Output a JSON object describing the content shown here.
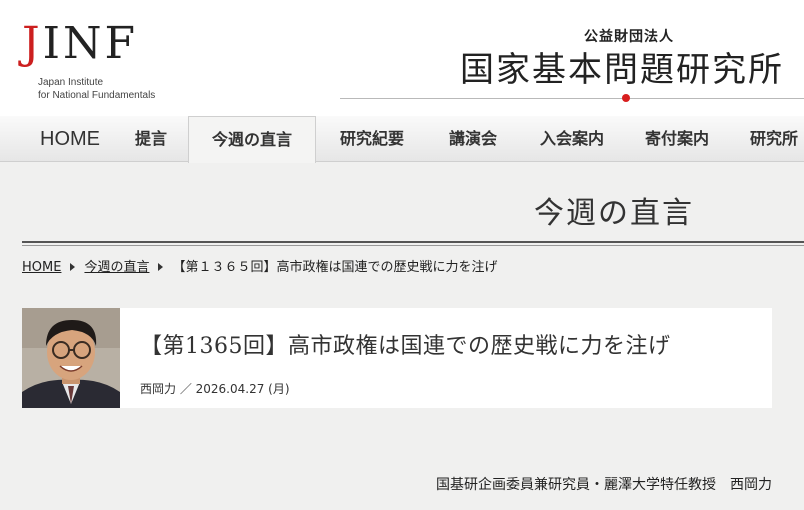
{
  "logo": {
    "letters_j": "J",
    "letters_rest": "INF",
    "en_line1": "Japan Institute",
    "en_line2": "for National Fundamentals"
  },
  "org": {
    "subtitle": "公益財団法人",
    "name": "国家基本問題研究所"
  },
  "nav": {
    "items": [
      {
        "label": "HOME"
      },
      {
        "label": "提言"
      },
      {
        "label": "今週の直言",
        "active": true
      },
      {
        "label": "研究紀要"
      },
      {
        "label": "講演会"
      },
      {
        "label": "入会案内"
      },
      {
        "label": "寄付案内"
      },
      {
        "label": "研究所"
      }
    ]
  },
  "section": {
    "title": "今週の直言"
  },
  "breadcrumb": {
    "home": "HOME",
    "parent": "今週の直言",
    "current": "【第１３６５回】高市政権は国連での歴史戦に力を注げ"
  },
  "article": {
    "title": "【第1365回】高市政権は国連での歴史戦に力を注げ",
    "meta": "西岡力 ／ 2026.04.27 (月)"
  },
  "byline": {
    "text": "国基研企画委員兼研究員・麗澤大学特任教授　西岡力"
  },
  "colors": {
    "accent_red": "#d81e1e",
    "page_bg": "#f0f0ef"
  }
}
